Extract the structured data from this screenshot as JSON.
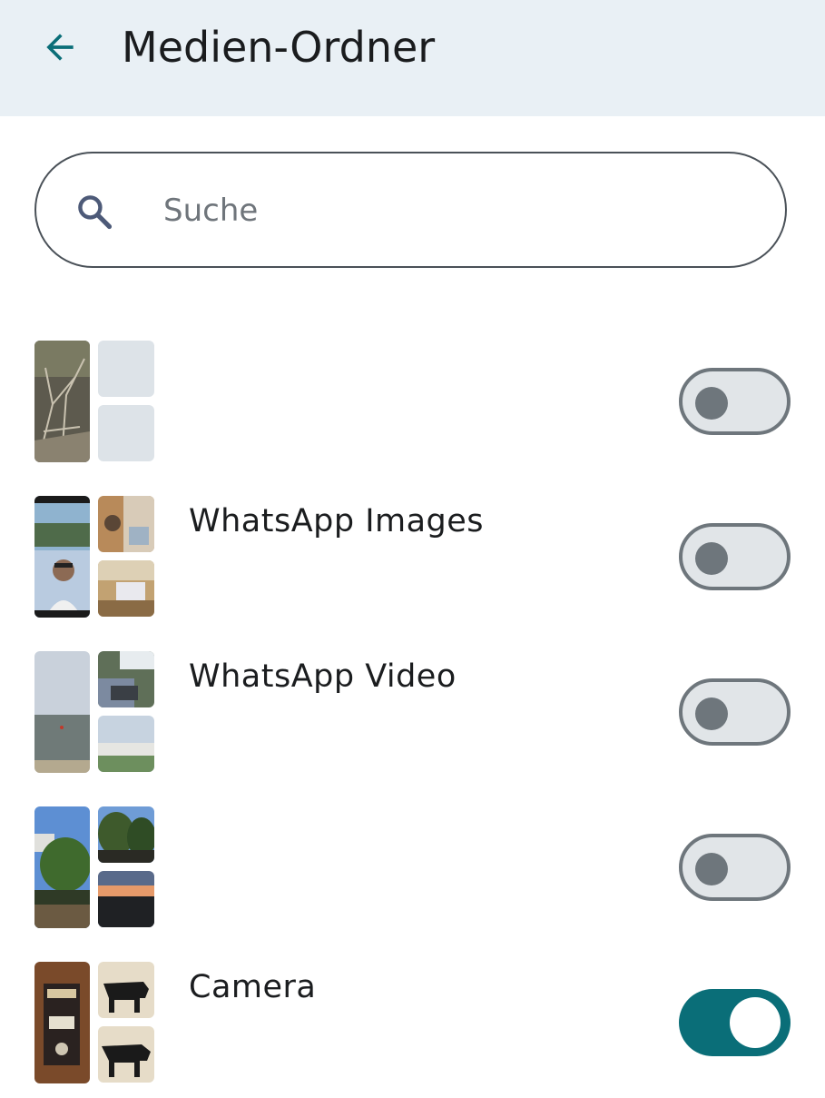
{
  "header": {
    "title": "Medien-Ordner",
    "back_icon": "arrow-left-icon"
  },
  "search": {
    "placeholder": "Suche",
    "value": "",
    "icon": "search-icon"
  },
  "colors": {
    "accent": "#0a6e78",
    "header_bg": "#e9f0f5",
    "toggle_off": "#6e767c"
  },
  "folders": [
    {
      "name": "",
      "enabled": false
    },
    {
      "name": "WhatsApp Images",
      "enabled": false
    },
    {
      "name": "WhatsApp Video",
      "enabled": false
    },
    {
      "name": "",
      "enabled": false
    },
    {
      "name": "Camera",
      "enabled": true
    }
  ]
}
